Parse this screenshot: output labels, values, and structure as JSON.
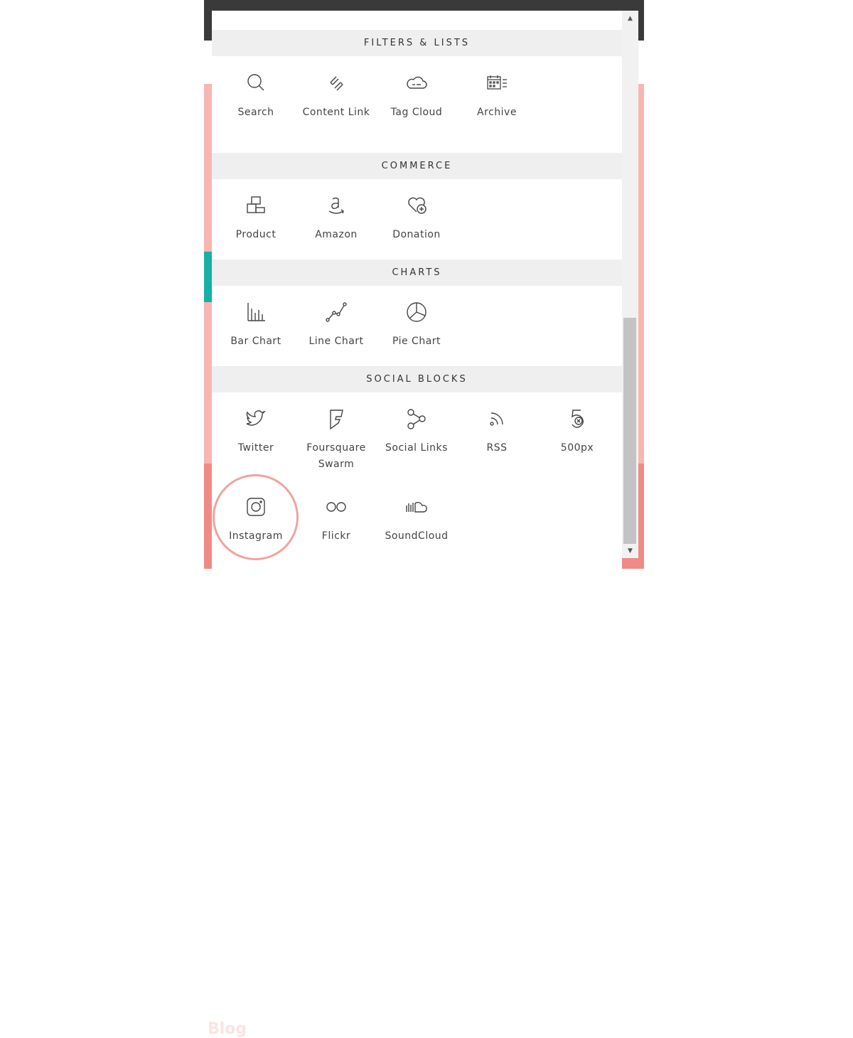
{
  "background": {
    "partial_heading": "Blog"
  },
  "sections": [
    {
      "title": "FILTERS & LISTS",
      "blocks": [
        {
          "label": "Search",
          "icon": "search-icon"
        },
        {
          "label": "Content Link",
          "icon": "content-link-icon"
        },
        {
          "label": "Tag Cloud",
          "icon": "tag-cloud-icon"
        },
        {
          "label": "Archive",
          "icon": "archive-icon"
        }
      ]
    },
    {
      "title": "COMMERCE",
      "blocks": [
        {
          "label": "Product",
          "icon": "product-icon"
        },
        {
          "label": "Amazon",
          "icon": "amazon-icon"
        },
        {
          "label": "Donation",
          "icon": "donation-icon"
        }
      ]
    },
    {
      "title": "CHARTS",
      "blocks": [
        {
          "label": "Bar Chart",
          "icon": "bar-chart-icon"
        },
        {
          "label": "Line Chart",
          "icon": "line-chart-icon"
        },
        {
          "label": "Pie Chart",
          "icon": "pie-chart-icon"
        }
      ]
    },
    {
      "title": "SOCIAL BLOCKS",
      "blocks": [
        {
          "label": "Twitter",
          "icon": "twitter-icon"
        },
        {
          "label": "Foursquare Swarm",
          "icon": "foursquare-icon"
        },
        {
          "label": "Social Links",
          "icon": "social-links-icon"
        },
        {
          "label": "RSS",
          "icon": "rss-icon"
        },
        {
          "label": "500px",
          "icon": "500px-icon"
        },
        {
          "label": "Instagram",
          "icon": "instagram-icon"
        },
        {
          "label": "Flickr",
          "icon": "flickr-icon"
        },
        {
          "label": "SoundCloud",
          "icon": "soundcloud-icon"
        }
      ]
    }
  ],
  "colors": {
    "highlight_ring": "#f0a49b",
    "section_bg": "#efefef",
    "teal_accent": "#16b0a6",
    "pink_bg": "#f8b6b2"
  },
  "scrollbar": {
    "up_arrow": "▲",
    "down_arrow": "▼"
  }
}
